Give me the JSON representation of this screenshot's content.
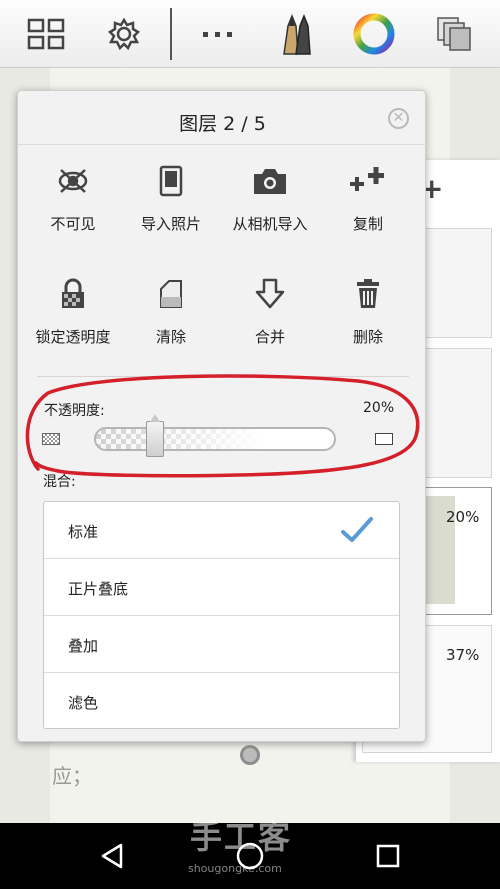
{
  "toolbar": {
    "icons": [
      "grid-icon",
      "gear-icon",
      "more-icon",
      "brush-tools-icon",
      "color-wheel-icon",
      "layers-icon"
    ]
  },
  "canvas": {
    "text_line1": "应；",
    "text_line2": "shougongke.com"
  },
  "layers_panel": {
    "layer_opacities": [
      "20%",
      "37%"
    ]
  },
  "popup": {
    "title": "图层 2 / 5",
    "actions": [
      {
        "label": "不可见",
        "icon": "hidden-eye-icon"
      },
      {
        "label": "导入照片",
        "icon": "photo-icon"
      },
      {
        "label": "从相机导入",
        "icon": "camera-icon"
      },
      {
        "label": "复制",
        "icon": "duplicate-icon"
      },
      {
        "label": "锁定透明度",
        "icon": "lock-icon"
      },
      {
        "label": "清除",
        "icon": "eraser-icon"
      },
      {
        "label": "合并",
        "icon": "merge-down-icon"
      },
      {
        "label": "删除",
        "icon": "trash-icon"
      }
    ],
    "opacity": {
      "label": "不透明度:",
      "value_text": "20%",
      "value": 0.2
    },
    "blend": {
      "label": "混合:",
      "modes": [
        "标准",
        "正片叠底",
        "叠加",
        "滤色"
      ],
      "selected": "标准"
    }
  },
  "watermark": {
    "text": "手工客",
    "url": "shougongke.com"
  },
  "colors": {
    "accent_check": "#5b9bd5",
    "annotation_red": "#d4202a"
  }
}
